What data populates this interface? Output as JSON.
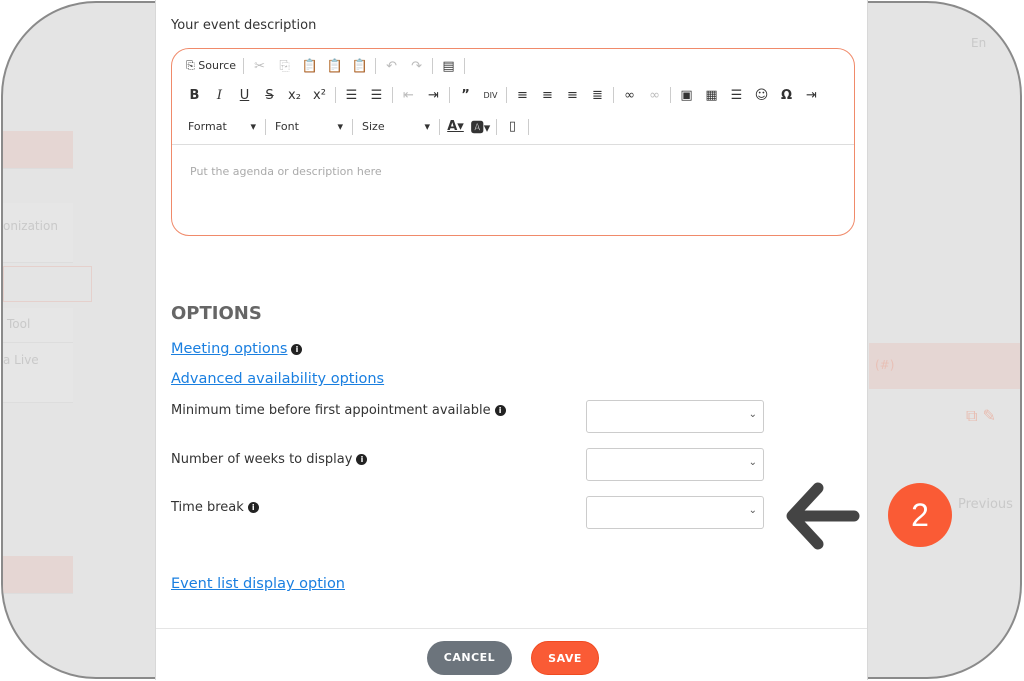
{
  "background": {
    "sidebar_items": [
      "onization",
      "Tool",
      "a Live"
    ],
    "language": "En",
    "table_header": "(#)",
    "pagination_prev": "Previous"
  },
  "editor": {
    "label": "Your event description",
    "source_label": "Source",
    "format_label": "Format",
    "font_label": "Font",
    "size_label": "Size",
    "placeholder": "Put the agenda or description here"
  },
  "options": {
    "title": "OPTIONS",
    "meeting_options": "Meeting options",
    "advanced_availability": "Advanced availability options",
    "fields": [
      {
        "label": "Minimum time before first appointment available",
        "value": ""
      },
      {
        "label": "Number of weeks to display",
        "value": ""
      },
      {
        "label": "Time break",
        "value": ""
      }
    ],
    "event_list_display": "Event list display option"
  },
  "buttons": {
    "cancel": "CANCEL",
    "save": "SAVE"
  },
  "annotation": {
    "step_number": "2",
    "arrow": "arrow-left-icon"
  },
  "colors": {
    "accent": "#fa5b35",
    "link": "#1a7fe0",
    "cancel": "#6c747c"
  }
}
